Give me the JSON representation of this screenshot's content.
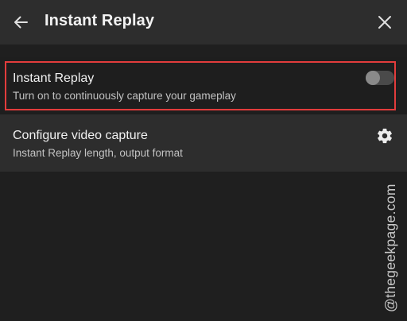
{
  "header": {
    "title": "Instant Replay",
    "back_icon": "arrow-left-icon",
    "close_icon": "close-icon"
  },
  "settings": [
    {
      "label": "Instant Replay",
      "description": "Turn on to continuously capture your gameplay",
      "control": "toggle",
      "toggle_on": false
    },
    {
      "label": "Configure video capture",
      "description": "Instant Replay length, output format",
      "control": "gear-icon"
    }
  ],
  "watermark": "@thegeekpage.com",
  "colors": {
    "background": "#1f1f1f",
    "header": "#2d2d2d",
    "highlight_border": "#e23c3c",
    "toggle_track": "#4a4a4a",
    "toggle_knob": "#8a8a8a"
  }
}
